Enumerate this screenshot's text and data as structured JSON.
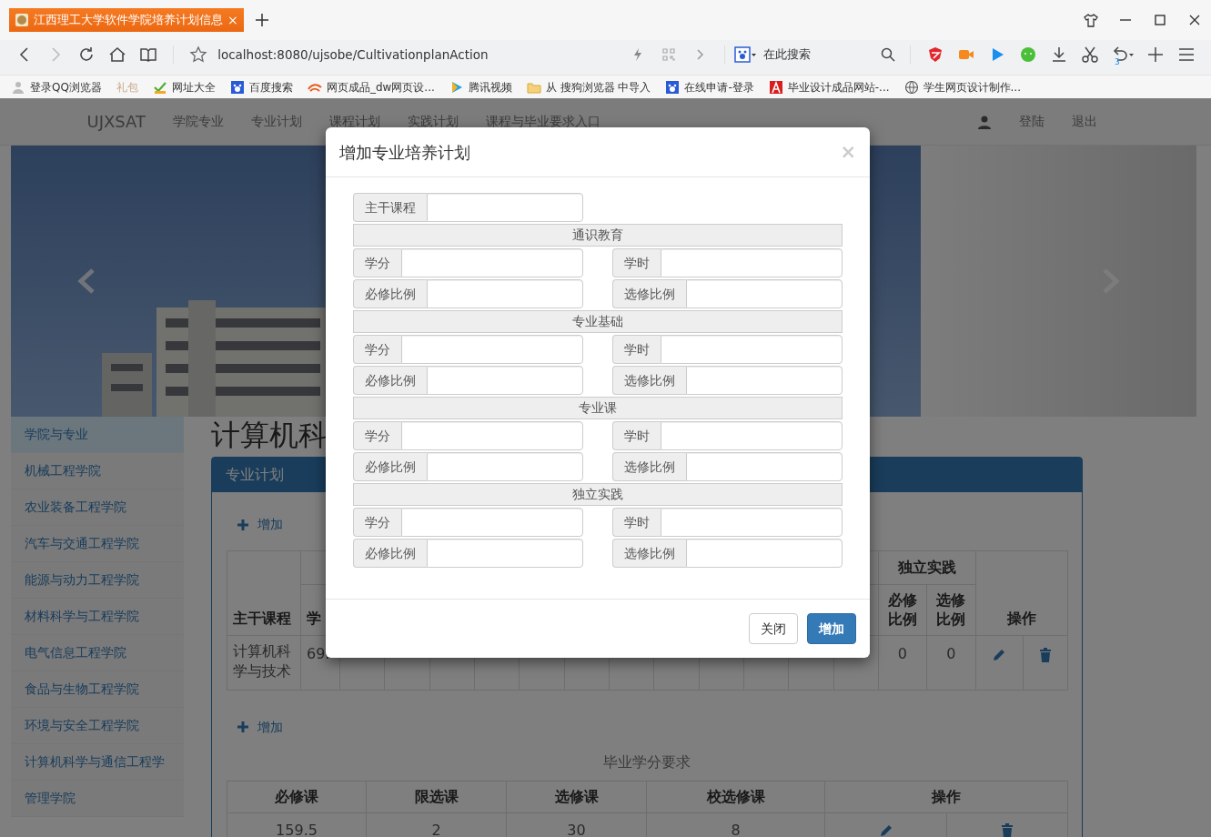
{
  "browser": {
    "tab": {
      "title": "江西理工大学软件学院培养计划信息",
      "close": "×"
    },
    "url": "localhost:8080/ujsobe/CultivationplanAction",
    "search_placeholder": "在此搜索",
    "undo_count": "3",
    "bookmarks": [
      {
        "label": "登录QQ浏览器",
        "muted": false
      },
      {
        "label": "礼包",
        "muted": true
      },
      {
        "label": "网址大全",
        "muted": false
      },
      {
        "label": "百度搜索",
        "muted": false
      },
      {
        "label": "网页成品_dw网页设...",
        "muted": false
      },
      {
        "label": "腾讯视频",
        "muted": false
      },
      {
        "label": "从 搜狗浏览器 中导入",
        "muted": false
      },
      {
        "label": "在线申请-登录",
        "muted": false
      },
      {
        "label": "毕业设计成品网站-...",
        "muted": false
      },
      {
        "label": "学生网页设计制作...",
        "muted": false
      }
    ]
  },
  "navbar": {
    "brand": "UJXSAT",
    "links": [
      "学院专业",
      "专业计划",
      "课程计划",
      "实践计划",
      "课程与毕业要求入口"
    ],
    "user_links": [
      "登陆",
      "退出"
    ]
  },
  "sidebar": {
    "items": [
      {
        "label": "学院与专业",
        "selected": true
      },
      {
        "label": "机械工程学院",
        "selected": false
      },
      {
        "label": "农业装备工程学院",
        "selected": false
      },
      {
        "label": "汽车与交通工程学院",
        "selected": false
      },
      {
        "label": "能源与动力工程学院",
        "selected": false
      },
      {
        "label": "材料科学与工程学院",
        "selected": false
      },
      {
        "label": "电气信息工程学院",
        "selected": false
      },
      {
        "label": "食品与生物工程学院",
        "selected": false
      },
      {
        "label": "环境与安全工程学院",
        "selected": false
      },
      {
        "label": "计算机科学与通信工程学",
        "selected": false
      },
      {
        "label": "管理学院",
        "selected": false
      }
    ]
  },
  "content": {
    "title": "计算机科",
    "plan_panel": {
      "title": "专业计划",
      "add_link": "增加",
      "table": {
        "main_course_heading": "主干课程",
        "credit_heading": "学",
        "group_heading": "独立实践",
        "ratio_headings": [
          "必修比例",
          "选修比例"
        ],
        "actions_heading": "操作",
        "rows": [
          {
            "course": "计算机科学与技术",
            "credit": "69.",
            "ratios": [
              "0",
              "0"
            ]
          }
        ]
      }
    },
    "requirements": {
      "add_link": "增加",
      "caption": "毕业学分要求",
      "columns": [
        "必修课",
        "限选课",
        "选修课",
        "校选修课",
        "操作"
      ],
      "rows": [
        {
          "cells": [
            "159.5",
            "2",
            "30",
            "8"
          ]
        }
      ]
    }
  },
  "modal": {
    "title": "增加专业培养计划",
    "close": "×",
    "main_course": {
      "label": "主干课程"
    },
    "sections": [
      {
        "title": "通识教育",
        "fields": [
          {
            "label": "学分"
          },
          {
            "label": "学时"
          },
          {
            "label": "必修比例"
          },
          {
            "label": "选修比例"
          }
        ]
      },
      {
        "title": "专业基础",
        "fields": [
          {
            "label": "学分"
          },
          {
            "label": "学时"
          },
          {
            "label": "必修比例"
          },
          {
            "label": "选修比例"
          }
        ]
      },
      {
        "title": "专业课",
        "fields": [
          {
            "label": "学分"
          },
          {
            "label": "学时"
          },
          {
            "label": "必修比例"
          },
          {
            "label": "选修比例"
          }
        ]
      },
      {
        "title": "独立实践",
        "fields": [
          {
            "label": "学分"
          },
          {
            "label": "学时"
          },
          {
            "label": "必修比例"
          },
          {
            "label": "选修比例"
          }
        ]
      }
    ],
    "buttons": [
      {
        "label": "关闭",
        "kind": "secondary"
      },
      {
        "label": "增加",
        "kind": "primary"
      }
    ]
  }
}
